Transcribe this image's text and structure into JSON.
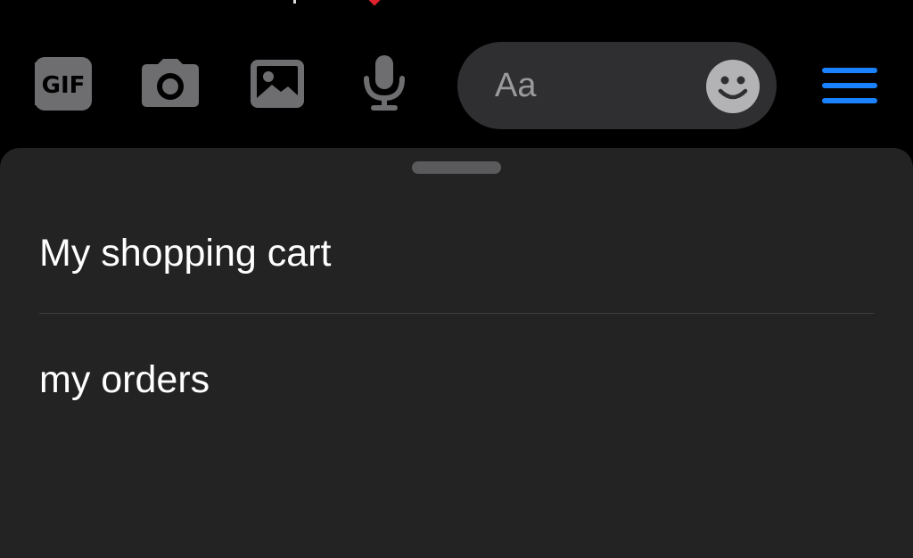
{
  "composer": {
    "placeholder": "Aa",
    "icons": [
      "gif-icon",
      "camera-icon",
      "image-icon",
      "microphone-icon",
      "emoji-icon",
      "menu-icon"
    ]
  },
  "sheet": {
    "options": [
      {
        "label": "My shopping cart"
      },
      {
        "label": "my orders"
      }
    ]
  },
  "colors": {
    "background": "#000000",
    "sheet": "#232323",
    "composer_field": "#2f2f31",
    "toolbar_icon": "#6e6e70",
    "accent": "#1a82ff",
    "text": "#ffffff",
    "placeholder": "#9a9a9c"
  }
}
